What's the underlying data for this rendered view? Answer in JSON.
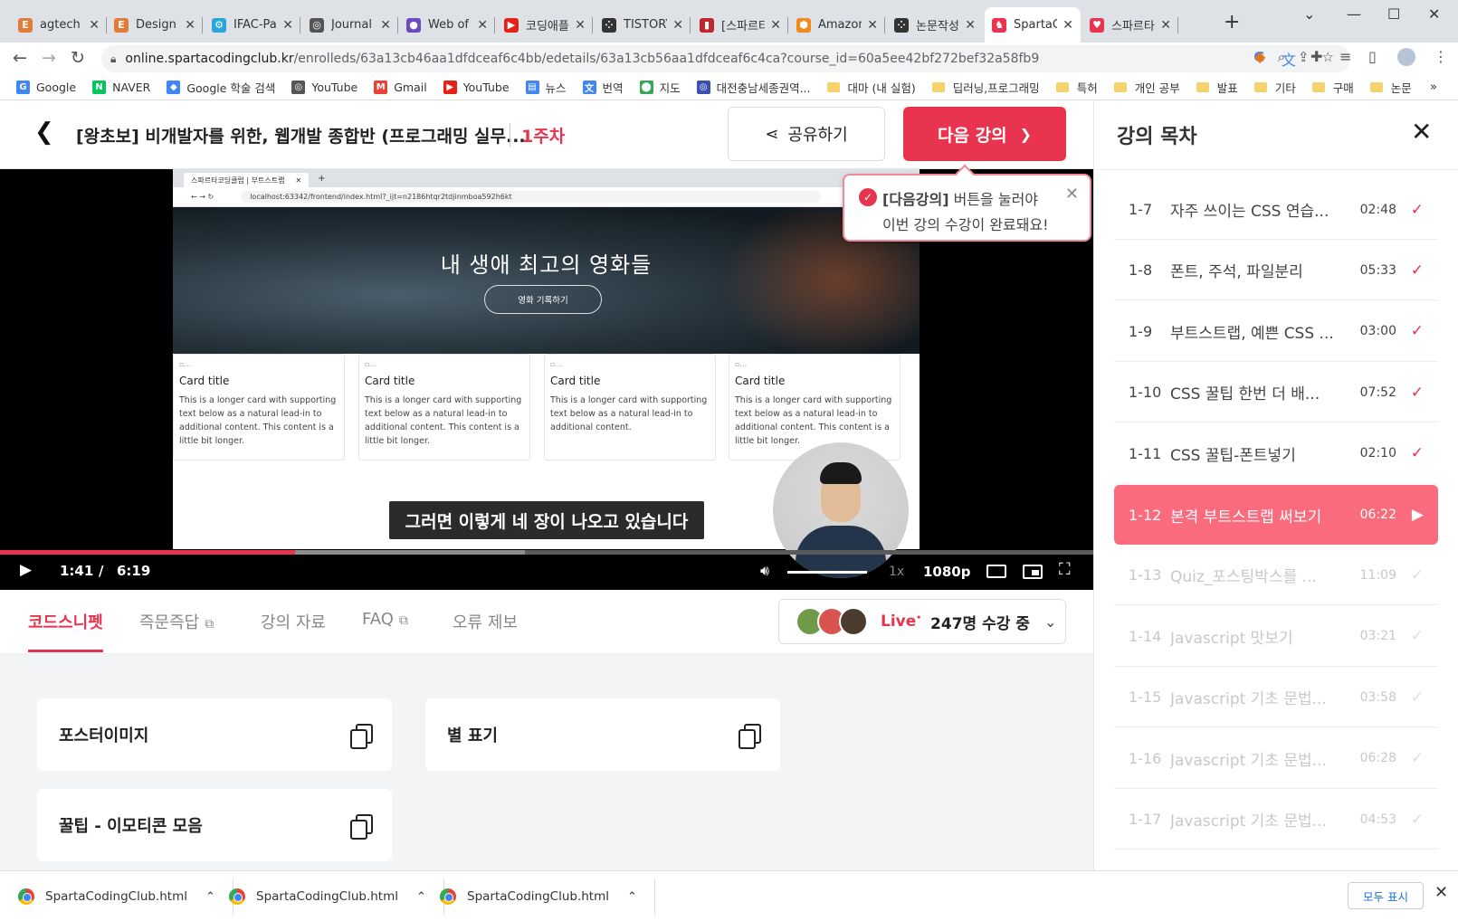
{
  "browser": {
    "tabs": [
      {
        "title": "agtech -",
        "icon": "letter-e-icon",
        "color": "#e07b39",
        "glyph": "E"
      },
      {
        "title": "Design a",
        "icon": "letter-e-icon",
        "color": "#e07b39",
        "glyph": "E"
      },
      {
        "title": "IFAC-Pap",
        "icon": "gear-icon",
        "color": "#2aa7d8",
        "glyph": "⚙"
      },
      {
        "title": "Journal |",
        "icon": "globe-icon",
        "color": "#555555",
        "glyph": "◎"
      },
      {
        "title": "Web of S",
        "icon": "wos-icon",
        "color": "#6b4bbd",
        "glyph": "●"
      },
      {
        "title": "코딩애플",
        "icon": "youtube-icon",
        "color": "#e62117",
        "glyph": "▶"
      },
      {
        "title": "TISTORY",
        "icon": "tistory-icon",
        "color": "#333333",
        "glyph": "⁘"
      },
      {
        "title": "[스파르타",
        "icon": "book-icon",
        "color": "#c0262d",
        "glyph": "▮"
      },
      {
        "title": "Amazon",
        "icon": "amazon-icon",
        "color": "#f08a1c",
        "glyph": "⬢"
      },
      {
        "title": "논문작성",
        "icon": "tistory-icon",
        "color": "#333333",
        "glyph": "⁘"
      },
      {
        "title": "SpartaCo",
        "icon": "sparta-icon",
        "color": "#e8344e",
        "glyph": "♞"
      },
      {
        "title": "스파르타",
        "icon": "heart-icon",
        "color": "#e8344e",
        "glyph": "♥"
      }
    ],
    "url_host": "online.spartacodingclub.kr",
    "url_path": "/enrolleds/63a13cb46aa1dfdceaf6c4bb/edetails/63a13cb56aa1dfdceaf6c4ca?course_id=60a5ee42bf272bef32a58fb9",
    "bookmarks": [
      {
        "label": "Google",
        "icon": "google-icon",
        "color": "#4285f4",
        "glyph": "G"
      },
      {
        "label": "NAVER",
        "icon": "naver-icon",
        "color": "#03c75a",
        "glyph": "N"
      },
      {
        "label": "Google 학술 검색",
        "icon": "scholar-icon",
        "color": "#4285f4",
        "glyph": "◆"
      },
      {
        "label": "YouTube",
        "icon": "globe-icon",
        "color": "#555555",
        "glyph": "◎"
      },
      {
        "label": "Gmail",
        "icon": "gmail-icon",
        "color": "#ea4335",
        "glyph": "M"
      },
      {
        "label": "YouTube",
        "icon": "youtube-icon",
        "color": "#e62117",
        "glyph": "▶"
      },
      {
        "label": "뉴스",
        "icon": "news-icon",
        "color": "#4285f4",
        "glyph": "▤"
      },
      {
        "label": "번역",
        "icon": "translate-icon",
        "color": "#4285f4",
        "glyph": "文"
      },
      {
        "label": "지도",
        "icon": "maps-icon",
        "color": "#34a853",
        "glyph": "⬤"
      },
      {
        "label": "대전충남세종권역...",
        "icon": "globe-icon",
        "color": "#3c4fb0",
        "glyph": "◎"
      }
    ],
    "folders": [
      "대마 (내 실험)",
      "딥러닝,프로그래밍",
      "특허",
      "개인 공부",
      "발표",
      "기타",
      "구매",
      "논문"
    ],
    "downloads": [
      "SpartaCodingClub.html",
      "SpartaCodingClub.html",
      "SpartaCodingClub.html"
    ],
    "show_all": "모두 표시"
  },
  "header": {
    "course_title": "[왕초보] 비개발자를 위한, 웹개발 종합반 (프로그래밍 실무...",
    "week": "1주차",
    "share": "공유하기",
    "next": "다음 강의"
  },
  "toast": {
    "bold": "[다음강의]",
    "line1_rest": " 버튼을 눌러야",
    "line2": "이번 강의 수강이 완료돼요!"
  },
  "video": {
    "inner_tab_title": "스파르타코딩클럽 | 부트스트랩",
    "inner_url": "localhost:63342/frontend/index.html?_ijt=n2186htqr2tdjinmboa592h6kt",
    "hero_title": "내 생애 최고의 영화들",
    "hero_button": "영화 기록하기",
    "cards": [
      {
        "title": "Card title",
        "text": "This is a longer card with supporting text below as a natural lead-in to additional content. This content is a little bit longer."
      },
      {
        "title": "Card title",
        "text": "This is a longer card with supporting text below as a natural lead-in to additional content. This content is a little bit longer."
      },
      {
        "title": "Card title",
        "text": "This is a longer card with supporting text below as a natural lead-in to additional content."
      },
      {
        "title": "Card title",
        "text": "This is a longer card with supporting text below as a natural lead-in to additional content. This content is a little bit longer."
      }
    ],
    "subtitle": "그러면 이렇게 네 장이 나오고 있습니다",
    "current_time": "1:41",
    "slash": "/",
    "duration": "6:19",
    "played_fraction": 0.27,
    "buffered_fraction": 0.48,
    "speed": "1x",
    "quality": "1080p"
  },
  "subtabs": [
    {
      "label": "코드스니펫",
      "external": false,
      "active": true
    },
    {
      "label": "즉문즉답",
      "external": true,
      "active": false
    },
    {
      "label": "강의 자료",
      "external": false,
      "active": false
    },
    {
      "label": "FAQ",
      "external": true,
      "active": false
    },
    {
      "label": "오류 제보",
      "external": false,
      "active": false
    }
  ],
  "live": {
    "label": "Live",
    "dot": "•",
    "count": "247명 수강 중"
  },
  "snippets": [
    "포스터이미지",
    "별 표기",
    "꿀팁 - 이모티콘 모음"
  ],
  "sidebar": {
    "title": "강의 목차",
    "lectures": [
      {
        "no": "1-7",
        "title": "자주 쓰이는 CSS 연습...",
        "dur": "02:48",
        "state": "done"
      },
      {
        "no": "1-8",
        "title": "폰트, 주석, 파일분리",
        "dur": "05:33",
        "state": "done"
      },
      {
        "no": "1-9",
        "title": "부트스트랩, 예쁜 CSS ...",
        "dur": "03:00",
        "state": "done"
      },
      {
        "no": "1-10",
        "title": "CSS 꿀팁 한번 더 배...",
        "dur": "07:52",
        "state": "done"
      },
      {
        "no": "1-11",
        "title": "CSS 꿀팁-폰트넣기",
        "dur": "02:10",
        "state": "done"
      },
      {
        "no": "1-12",
        "title": "본격 부트스트랩 써보기",
        "dur": "06:22",
        "state": "current"
      },
      {
        "no": "1-13",
        "title": "Quiz_포스팅박스를 ...",
        "dur": "11:09",
        "state": "todo"
      },
      {
        "no": "1-14",
        "title": "Javascript 맛보기",
        "dur": "03:21",
        "state": "todo"
      },
      {
        "no": "1-15",
        "title": "Javascript 기초 문법...",
        "dur": "03:58",
        "state": "todo"
      },
      {
        "no": "1-16",
        "title": "Javascript 기초 문법...",
        "dur": "06:28",
        "state": "todo"
      },
      {
        "no": "1-17",
        "title": "Javascript 기초 문법...",
        "dur": "04:53",
        "state": "todo"
      }
    ]
  },
  "colors": {
    "accent": "#e8344e",
    "current_row": "#fa6b7d"
  }
}
